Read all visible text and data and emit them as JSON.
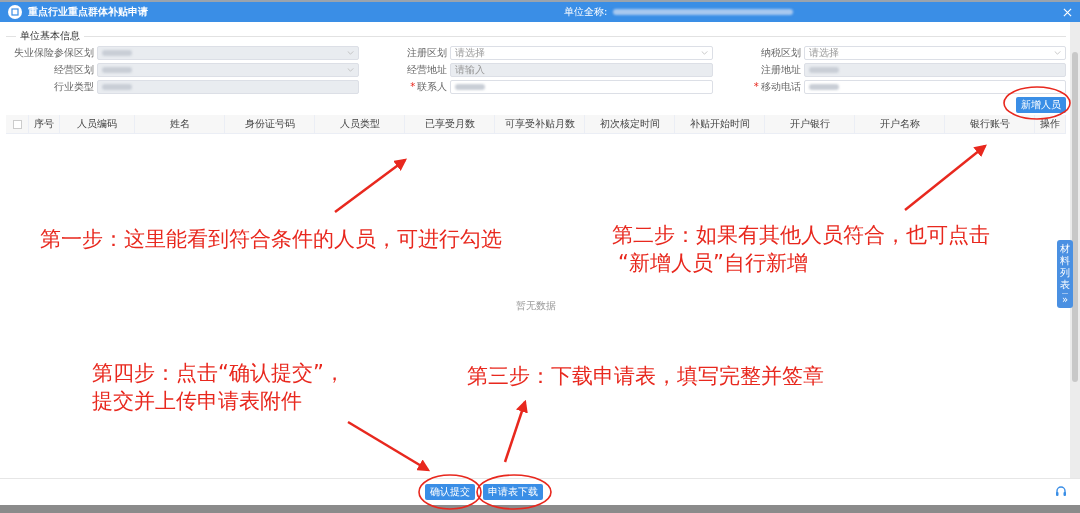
{
  "window": {
    "title": "重点行业重点群体补贴申请",
    "unit_label": "单位全称:"
  },
  "section": {
    "title": "单位基本信息"
  },
  "fields": [
    {
      "label": "失业保险参保区划",
      "kind": "select",
      "disabled": true,
      "redacted": true
    },
    {
      "label": "注册区划",
      "kind": "select",
      "disabled": false,
      "placeholder": "请选择"
    },
    {
      "label": "纳税区划",
      "kind": "select",
      "disabled": false,
      "placeholder": "请选择"
    },
    {
      "label": "经营区划",
      "kind": "select",
      "disabled": true,
      "redacted": true
    },
    {
      "label": "经营地址",
      "kind": "input",
      "disabled": true,
      "placeholder": "请输入"
    },
    {
      "label": "注册地址",
      "kind": "input",
      "disabled": true,
      "redacted": true
    },
    {
      "label": "行业类型",
      "kind": "input",
      "disabled": true,
      "redacted": true
    },
    {
      "label": "联系人",
      "kind": "input",
      "disabled": false,
      "required_mark": "*",
      "redacted": true
    },
    {
      "label": "移动电话",
      "kind": "input",
      "disabled": false,
      "required_mark": "*",
      "redacted": true
    }
  ],
  "add_button": "新增人员",
  "table": {
    "select_all": {
      "checked": false
    },
    "columns": [
      "序号",
      "人员编码",
      "姓名",
      "身份证号码",
      "人员类型",
      "已享受月数",
      "可享受补贴月数",
      "初次核定时间",
      "补贴开始时间",
      "开户银行",
      "开户名称",
      "银行账号",
      "操作"
    ],
    "empty_text": "暂无数据"
  },
  "side_tab": {
    "label": "材料列表",
    "arrow": "»"
  },
  "footer_buttons": [
    "确认提交",
    "申请表下载"
  ],
  "annotations": [
    {
      "text": "第一步：这里能看到符合条件的人员，可进行勾选"
    },
    {
      "text": "第二步：如果有其他人员符合，也可点击"
    },
    {
      "text": "“新增人员”自行新增"
    },
    {
      "text": "第四步：点击“确认提交”，"
    },
    {
      "text": "提交并上传申请表附件"
    },
    {
      "text": "第三步：下载申请表，填写完整并签章"
    }
  ]
}
